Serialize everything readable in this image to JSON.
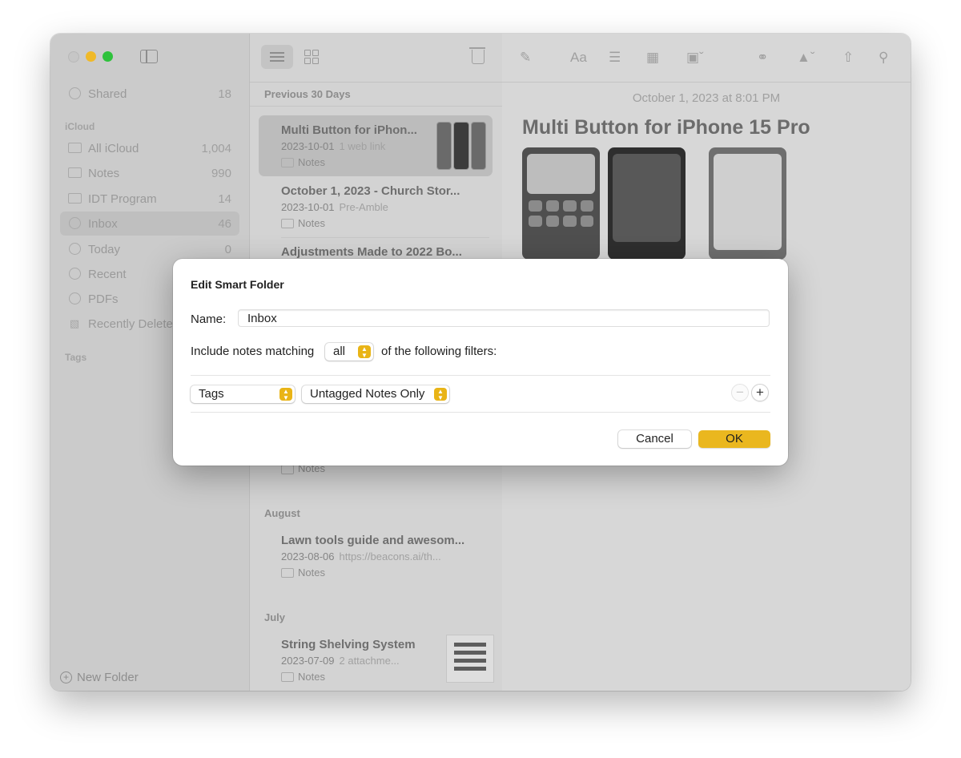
{
  "colors": {
    "accent": "#eab71f",
    "traffic_minimize": "#f0b928",
    "traffic_maximize": "#2fc23c",
    "dialog_background": "#ffffff"
  },
  "sidebar": {
    "shared": {
      "label": "Shared",
      "count": "18",
      "icon": "shared-icon"
    },
    "section_icloud": "iCloud",
    "items": [
      {
        "label": "All iCloud",
        "count": "1,004",
        "icon": "folder-icon"
      },
      {
        "label": "Notes",
        "count": "990",
        "icon": "folder-icon"
      },
      {
        "label": "IDT Program",
        "count": "14",
        "icon": "folder-icon"
      },
      {
        "label": "Inbox",
        "count": "46",
        "icon": "gear-icon",
        "selected": true
      },
      {
        "label": "Today",
        "count": "0",
        "icon": "gear-icon"
      },
      {
        "label": "Recent",
        "count": "",
        "icon": "gear-icon"
      },
      {
        "label": "PDFs",
        "count": "",
        "icon": "gear-icon"
      },
      {
        "label": "Recently Deleted",
        "count": "",
        "icon": "trash-icon"
      }
    ],
    "section_tags": "Tags",
    "new_folder": "New Folder"
  },
  "note_list": {
    "groups": [
      {
        "header": "Previous 30 Days",
        "notes": [
          {
            "title": "Multi Button for iPhon...",
            "date": "2023-10-01",
            "preview": "1 web link",
            "folder": "Notes",
            "selected": true
          },
          {
            "title": "October 1, 2023 - Church Stor...",
            "date": "2023-10-01",
            "preview": "Pre-Amble",
            "folder": "Notes"
          },
          {
            "title": "Adjustments Made to 2022 Bo...",
            "date": "",
            "preview": "",
            "folder": ""
          }
        ],
        "trailing_folder": "Notes"
      },
      {
        "header": "August",
        "notes": [
          {
            "title": "Lawn tools guide and awesom...",
            "date": "2023-08-06",
            "preview": "https://beacons.ai/th...",
            "folder": "Notes"
          }
        ]
      },
      {
        "header": "July",
        "notes": [
          {
            "title": "String Shelving System",
            "date": "2023-07-09",
            "preview": "2 attachme...",
            "folder": "Notes"
          }
        ]
      }
    ]
  },
  "editor": {
    "date": "October 1, 2023 at 8:01 PM",
    "title": "Multi Button for iPhone 15 Pro",
    "toolbar": {
      "format_label": "Aa"
    }
  },
  "dialog": {
    "title": "Edit Smart Folder",
    "name_label": "Name:",
    "name_value": "Inbox",
    "match_prefix": "Include notes matching",
    "match_value": "all",
    "match_suffix": "of the following filters:",
    "filter": {
      "field": "Tags",
      "condition": "Untagged Notes Only"
    },
    "remove_label": "−",
    "add_label": "+",
    "cancel_label": "Cancel",
    "ok_label": "OK"
  }
}
